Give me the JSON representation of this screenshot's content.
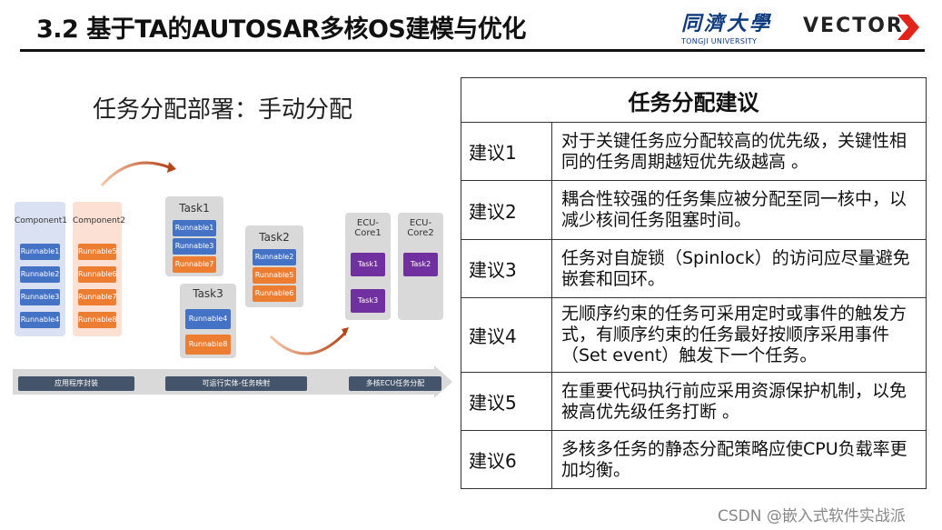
{
  "header": {
    "title": "3.2 基于TA的AUTOSAR多核OS建模与优化",
    "logo_cn": "同濟大學",
    "logo_en": "TONGJI UNIVERSITY",
    "vector": "VECTOR"
  },
  "left": {
    "title": "任务分配部署：手动分配",
    "components": [
      {
        "label": "Component1",
        "runnables": [
          "Runnable1",
          "Runnable2",
          "Runnable3",
          "Runnable4"
        ]
      },
      {
        "label": "Component2",
        "runnables": [
          "Runnable5",
          "Runnable6",
          "Runnable7",
          "Runnable8"
        ]
      }
    ],
    "tasks": [
      {
        "label": "Task1",
        "runnables": [
          "Runnable1",
          "Runnable3",
          "Runnable7"
        ]
      },
      {
        "label": "Task2",
        "runnables": [
          "Runnable2",
          "Runnable5",
          "Runnable6"
        ]
      },
      {
        "label": "Task3",
        "runnables": [
          "Runnable4",
          "Runnable8"
        ]
      }
    ],
    "cores": [
      {
        "label": "ECU-\nCore1",
        "tasks": [
          "Task1",
          "Task3"
        ]
      },
      {
        "label": "ECU-\nCore2",
        "tasks": [
          "Task2"
        ]
      }
    ],
    "stages": [
      "应用程序封装",
      "可运行实体-任务映射",
      "多核ECU任务分配"
    ]
  },
  "table": {
    "header": "任务分配建议",
    "rows": [
      {
        "label": "建议1",
        "text": "对于关键任务应分配较高的优先级，关键性相同的任务周期越短优先级越高 。"
      },
      {
        "label": "建议2",
        "text": "耦合性较强的任务集应被分配至同一核中，以减少核间任务阻塞时间。"
      },
      {
        "label": "建议3",
        "text": "任务对自旋锁（Spinlock）的访问应尽量避免嵌套和回环。"
      },
      {
        "label": "建议4",
        "text": "无顺序约束的任务可采用定时或事件的触发方式，有顺序约束的任务最好按顺序采用事件（Set event）触发下一个任务。"
      },
      {
        "label": "建议5",
        "text": "在重要代码执行前应采用资源保护机制，以免被高优先级任务打断 。"
      },
      {
        "label": "建议6",
        "text": "多核多任务的静态分配策略应使CPU负载率更加均衡。"
      }
    ]
  },
  "watermark": "CSDN @嵌入式软件实战派",
  "colors": {
    "blue": "#4472c4",
    "orange": "#ed7d31",
    "purple": "#7030a0",
    "vector_red": "#e2231a"
  }
}
